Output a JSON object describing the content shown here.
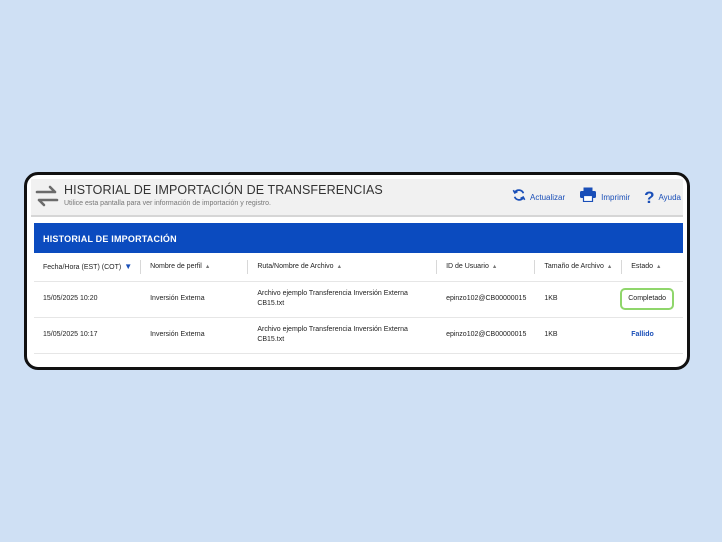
{
  "header": {
    "title": "HISTORIAL DE IMPORTACIÓN DE TRANSFERENCIAS",
    "subtitle": "Utilice esta pantalla para ver información de importación y registro.",
    "icon": "transfer-arrows-icon",
    "actions": [
      {
        "label": "Actualizar",
        "icon": "refresh-icon"
      },
      {
        "label": "Imprimir",
        "icon": "printer-icon"
      },
      {
        "label": "Ayuda",
        "icon": "help-icon"
      }
    ]
  },
  "panel": {
    "title": "HISTORIAL DE IMPORTACIÓN",
    "columns": [
      {
        "label": "Fecha/Hora (EST) (COT)",
        "sort": "desc-active"
      },
      {
        "label": "Nombre de perfil",
        "sort": "asc"
      },
      {
        "label": "Ruta/Nombre de Archivo",
        "sort": "asc"
      },
      {
        "label": "ID de Usuario",
        "sort": "asc"
      },
      {
        "label": "Tamaño de Archivo",
        "sort": "asc"
      },
      {
        "label": "Estado",
        "sort": "asc"
      }
    ],
    "rows": [
      {
        "datetime": "15/05/2025 10:20",
        "profile": "Inversión Externa",
        "file_line1": "Archivo ejemplo Transferencia Inversión Externa",
        "file_line2": "CB15.txt",
        "user_id": "epinzo102@CB00000015",
        "size": "1KB",
        "status": "Completado"
      },
      {
        "datetime": "15/05/2025 10:17",
        "profile": "Inversión Externa",
        "file_line1": "Archivo ejemplo Transferencia Inversión Externa",
        "file_line2": "CB15.txt",
        "user_id": "epinzo102@CB00000015",
        "size": "1KB",
        "status": "Fallido"
      }
    ]
  },
  "colors": {
    "page_background": "#cfe0f4",
    "panel_bar": "#0b4bbf",
    "link": "#1a4fb8",
    "completed_outline": "#8fd66b"
  }
}
